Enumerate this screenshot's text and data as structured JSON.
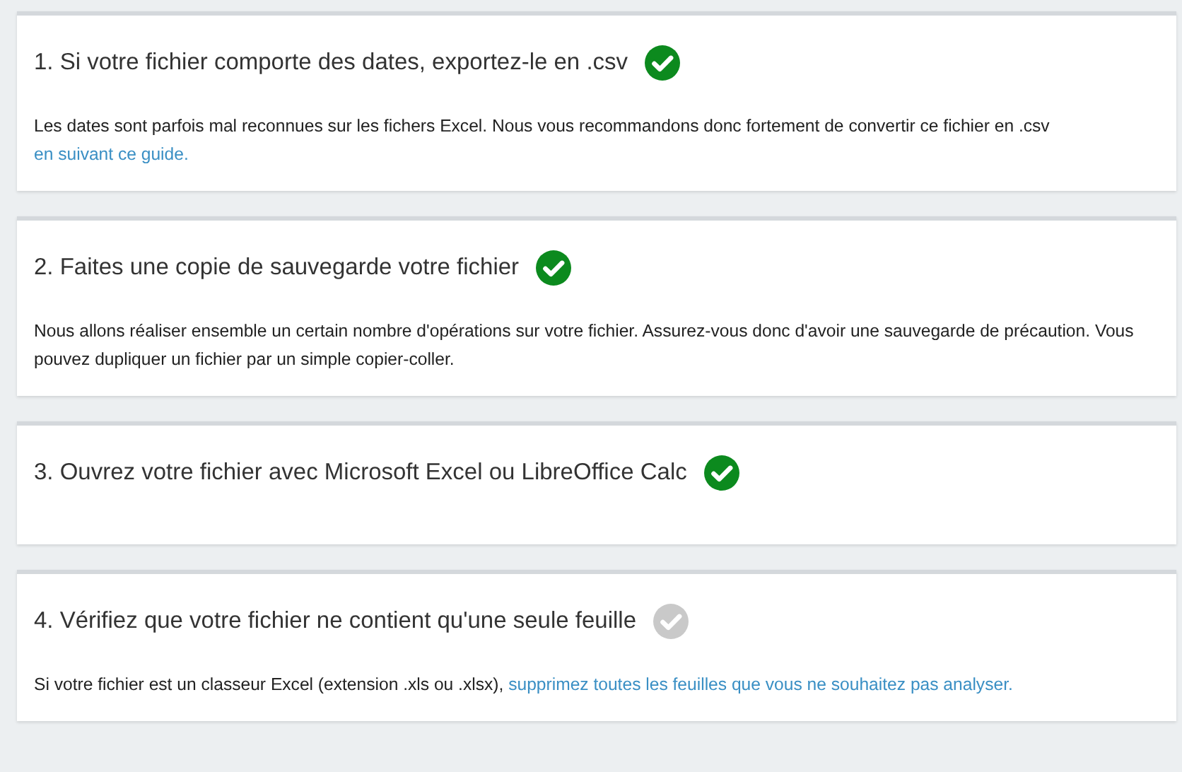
{
  "steps": [
    {
      "title": "1. Si votre fichier comporte des dates, exportez-le en .csv",
      "done": true,
      "text": "Les dates sont parfois mal reconnues sur les fichers Excel. Nous vous recommandons donc fortement de convertir ce fichier en .csv",
      "link": "en suivant ce guide."
    },
    {
      "title": "2. Faites une copie de sauvegarde votre fichier",
      "done": true,
      "text": "Nous allons réaliser ensemble un certain nombre d'opérations sur votre fichier. Assurez-vous donc d'avoir une sauvegarde de précaution. Vous pouvez dupliquer un fichier par un simple copier-coller."
    },
    {
      "title": "3. Ouvrez votre fichier avec Microsoft Excel ou LibreOffice Calc",
      "done": true
    },
    {
      "title": "4. Vérifiez que votre fichier ne contient qu'une seule feuille",
      "done": false,
      "text": "Si votre fichier est un classeur Excel (extension .xls ou .xlsx),",
      "link": "supprimez toutes les feuilles que vous ne souhaitez pas analyser."
    }
  ]
}
